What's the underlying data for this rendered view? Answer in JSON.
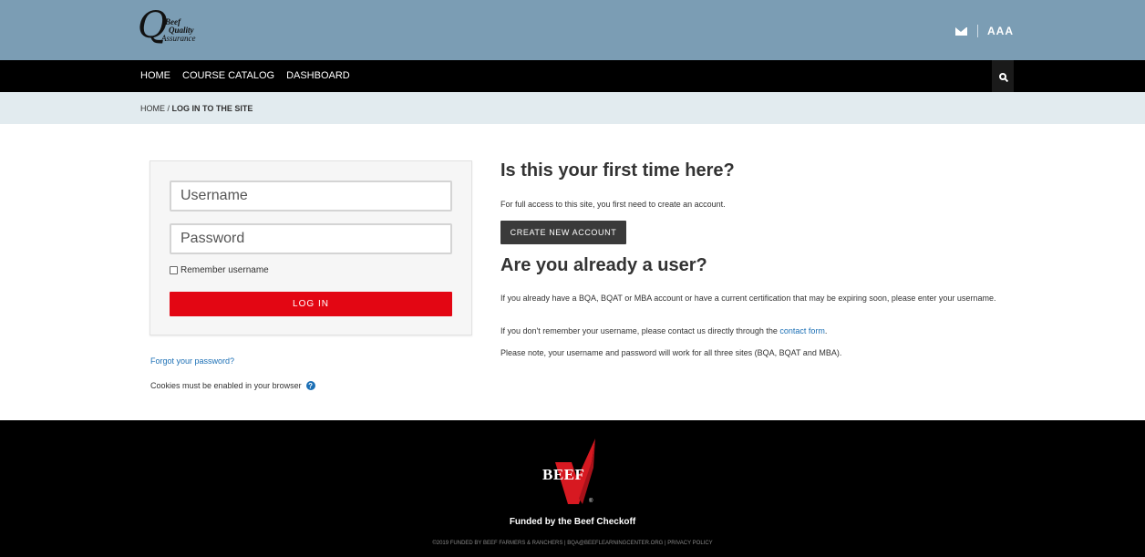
{
  "header": {
    "logo_line1": "Beef",
    "logo_line2": "Quality",
    "logo_line3": "Assurance",
    "font_size_label": "AAA"
  },
  "nav": {
    "items": [
      {
        "label": "HOME"
      },
      {
        "label": "COURSE CATALOG"
      },
      {
        "label": "DASHBOARD"
      }
    ]
  },
  "breadcrumb": {
    "home": "HOME",
    "separator": "/",
    "current": "LOG IN TO THE SITE"
  },
  "login": {
    "username_placeholder": "Username",
    "password_placeholder": "Password",
    "remember_label": "Remember username",
    "login_button": "LOG IN",
    "forgot_link": "Forgot your password?",
    "cookies_text": "Cookies must be enabled in your browser"
  },
  "first_time": {
    "heading": "Is this your first time here?",
    "text": "For full access to this site, you first need to create an account.",
    "create_button": "CREATE NEW ACCOUNT"
  },
  "existing_user": {
    "heading": "Are you already a user?",
    "text1": "If you already have a BQA, BQAT or MBA account or have a current certification that may be expiring soon, please enter your username.",
    "text2_prefix": "If you don't remember your username, please contact us directly through the ",
    "text2_link": "contact form",
    "text2_suffix": ".",
    "text3": "Please note, your username and password will work for all three sites (BQA, BQAT and MBA)."
  },
  "footer": {
    "logo_text": "BEEF",
    "registered": "®",
    "funded": "Funded by the Beef Checkoff",
    "copyright": "©2019 FUNDED BY BEEF FARMERS & RANCHERS | BQA@BEEFLEARNINGCENTER.ORG | PRIVACY POLICY"
  },
  "colors": {
    "header_bg": "#7b9db4",
    "nav_bg": "#000000",
    "breadcrumb_bg": "#e2ebef",
    "login_button": "#e30613",
    "create_button": "#3a3a3a",
    "link": "#1b6fb5"
  },
  "icons": {
    "mail": "envelope-icon",
    "search": "search-icon",
    "help": "help-icon",
    "checkbox": "checkbox-icon"
  }
}
